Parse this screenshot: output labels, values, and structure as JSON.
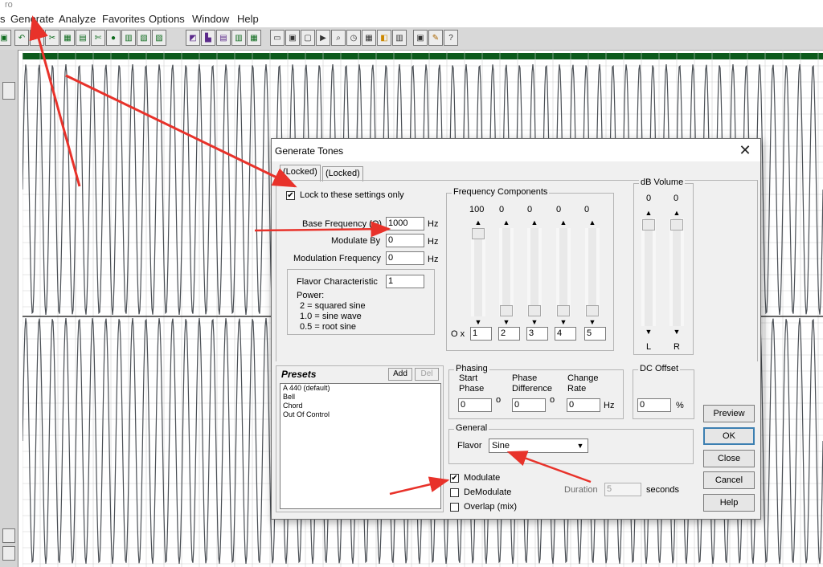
{
  "window": {
    "title_fragment": "ro"
  },
  "menu": [
    "s",
    "Generate",
    "Analyze",
    "Favorites",
    "Options",
    "Window",
    "Help"
  ],
  "toolbar": {
    "icons": [
      "undo-icon",
      "redo-icon",
      "cut-icon",
      "copy-icon",
      "paste-icon",
      "scissors-icon",
      "mic-icon",
      "save-icon",
      "tools-icon",
      "record-icon",
      "mix-icon",
      "spectrum-icon",
      "cue-icon",
      "marker-icon",
      "list-icon",
      "view-icon",
      "play-icon",
      "loop-icon",
      "zoom-icon",
      "timer-icon",
      "meter-icon",
      "settings-icon",
      "help-icon"
    ]
  },
  "dialog": {
    "title": "Generate Tones",
    "tabs": [
      "(Locked)",
      "(Locked)"
    ],
    "lock_label": "Lock to these settings only",
    "base_freq_label": "Base Frequency (Q)",
    "base_freq_value": "1000",
    "modulate_by_label": "Modulate By",
    "modulate_by_value": "0",
    "mod_freq_label": "Modulation Frequency",
    "mod_freq_value": "0",
    "hz": "Hz",
    "flavor_char": {
      "label": "Flavor Characteristic",
      "value": "1",
      "power_label": "Power:",
      "power_lines": [
        "2 = squared sine",
        "1.0 = sine wave",
        "0.5 = root sine"
      ]
    },
    "freq_components": {
      "title": "Frequency Components",
      "levels": [
        "100",
        "0",
        "0",
        "0",
        "0"
      ],
      "level_fractions": [
        1.0,
        0.0,
        0.0,
        0.0,
        0.0
      ],
      "multiplier_label": "O x",
      "multipliers": [
        "1",
        "2",
        "3",
        "4",
        "5"
      ]
    },
    "db_volume": {
      "title": "dB Volume",
      "levels": [
        "0",
        "0"
      ],
      "channels": [
        "L",
        "R"
      ]
    },
    "presets": {
      "title": "Presets",
      "add_label": "Add",
      "del_label": "Del",
      "items": [
        "A 440 (default)",
        "Bell",
        "Chord",
        "Out Of Control"
      ]
    },
    "phasing": {
      "title": "Phasing",
      "start_label_1": "Start",
      "start_label_2": "Phase",
      "diff_label_1": "Phase",
      "diff_label_2": "Difference",
      "rate_label_1": "Change",
      "rate_label_2": "Rate",
      "start_value": "0",
      "diff_value": "0",
      "rate_value": "0",
      "degree": "o",
      "hz": "Hz"
    },
    "dc_offset": {
      "title": "DC Offset",
      "value": "0",
      "unit": "%"
    },
    "general": {
      "title": "General",
      "flavor_label": "Flavor",
      "flavor_value": "Sine"
    },
    "checks": {
      "modulate": {
        "label": "Modulate",
        "checked": true
      },
      "demodulate": {
        "label": "DeModulate",
        "checked": false
      },
      "overlap": {
        "label": "Overlap (mix)",
        "checked": false
      }
    },
    "duration": {
      "label": "Duration",
      "value": "5",
      "unit": "seconds"
    },
    "buttons": {
      "preview": "Preview",
      "ok": "OK",
      "close": "Close",
      "cancel": "Cancel",
      "help": "Help"
    },
    "check_mark": "✔"
  },
  "annotation_color": "#e8322a",
  "waveform_color": "#4a4f55",
  "grid_color": "#d0d0d0"
}
